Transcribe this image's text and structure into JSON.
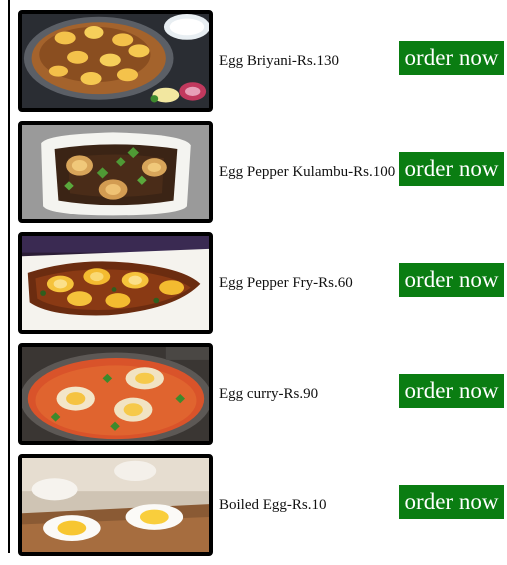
{
  "menu": {
    "items": [
      {
        "name": "Egg Briyani-Rs.130",
        "button_label": "order now",
        "image_icon": "egg-biryani-photo"
      },
      {
        "name": "Egg Pepper Kulambu-Rs.100",
        "button_label": "order now",
        "image_icon": "egg-pepper-kulambu-photo"
      },
      {
        "name": "Egg Pepper Fry-Rs.60",
        "button_label": "order now",
        "image_icon": "egg-pepper-fry-photo"
      },
      {
        "name": "Egg curry-Rs.90",
        "button_label": "order now",
        "image_icon": "egg-curry-photo"
      },
      {
        "name": "Boiled Egg-Rs.10",
        "button_label": "order now",
        "image_icon": "boiled-egg-photo"
      }
    ],
    "colors": {
      "button_bg": "#0a7d12",
      "button_text": "#ffffff",
      "thumb_border": "#000000"
    }
  }
}
